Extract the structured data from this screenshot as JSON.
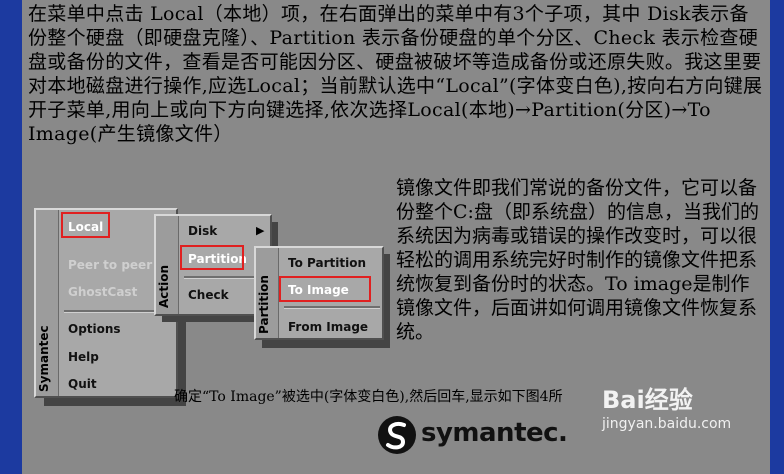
{
  "intro_text": "在菜单中点击 Local（本地）项，在右面弹出的菜单中有3个子项，其中 Disk表示备份整个硬盘（即硬盘克隆）、Partition 表示备份硬盘的单个分区、Check 表示检查硬盘或备份的文件，查看是否可能因分区、硬盘被破坏等造成备份或还原失败。我这里要对本地磁盘进行操作,应选Local；当前默认选中“Local”(字体变白色),按向右方向键展开子菜单,用向上或向下方向键选择,依次选择Local(本地)→Partition(分区)→To Image(产生镜像文件）",
  "right_text": "镜像文件即我们常说的备份文件，它可以备份整个C:盘（即系统盘）的信息，当我们的系统因为病毒或错误的操作改变时，可以很轻松的调用系统完好时制作的镜像文件把系统恢复到备份时的状态。To image是制作镜像文件，后面讲如何调用镜像文件恢复系统。",
  "bottom_text": "确定“To Image”被选中(字体变白色),然后回车,显示如下图4所",
  "main_menu": {
    "strip": "Symantec",
    "items": [
      {
        "label": "Local",
        "state": "selected"
      },
      {
        "label": "Peer to peer",
        "state": "disabled"
      },
      {
        "label": "GhostCast",
        "state": "disabled"
      },
      {
        "label": "Options",
        "state": "normal"
      },
      {
        "label": "Help",
        "state": "normal"
      },
      {
        "label": "Quit",
        "state": "normal"
      }
    ]
  },
  "action_menu": {
    "strip": "Action",
    "items": [
      {
        "label": "Disk",
        "state": "normal"
      },
      {
        "label": "Partition",
        "state": "selected"
      },
      {
        "label": "Check",
        "state": "normal"
      }
    ]
  },
  "partition_menu": {
    "strip": "Partition",
    "items": [
      {
        "label": "To Partition",
        "state": "normal"
      },
      {
        "label": "To Image",
        "state": "selected"
      },
      {
        "label": "From Image",
        "state": "normal"
      }
    ]
  },
  "logo": {
    "text": "symantec.",
    "icon": "symantec-logo-icon"
  },
  "watermark": {
    "brand": "Bai经验",
    "url": "jingyan.baidu.com"
  },
  "colors": {
    "highlight": "#e02020",
    "menu_bg": "#a8a8a8",
    "edge": "#1c3aa0"
  }
}
